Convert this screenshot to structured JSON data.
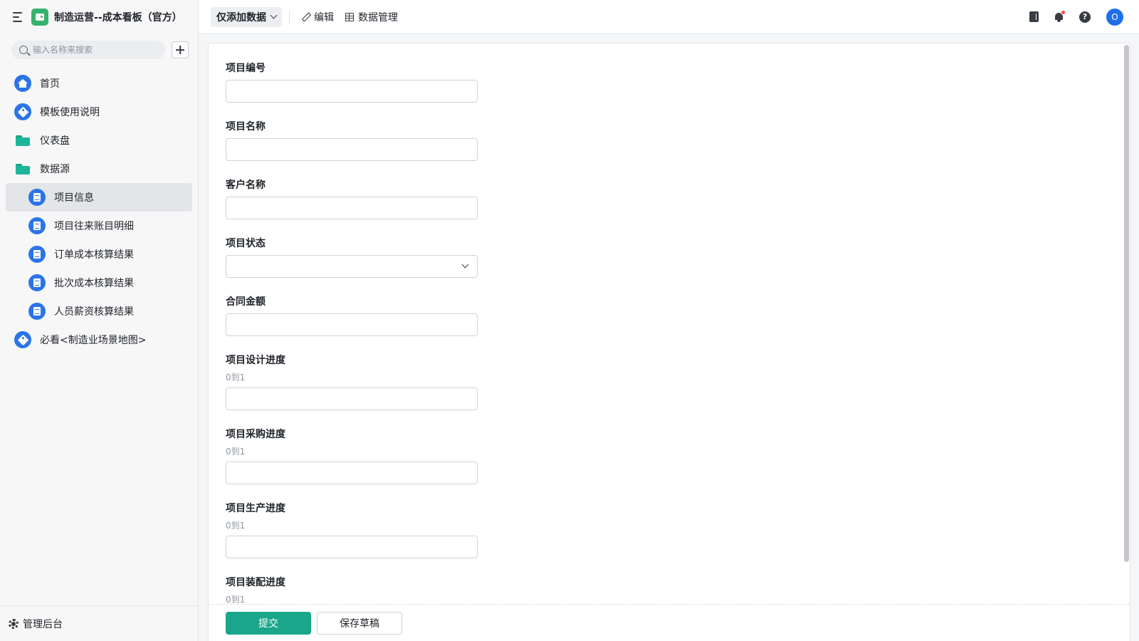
{
  "app": {
    "title": "制造运营--成本看板（官方）"
  },
  "search": {
    "placeholder": "输入名称来搜索"
  },
  "nav": {
    "home": "首页",
    "guide": "模板使用说明",
    "dashboard": "仪表盘",
    "datasource": "数据源",
    "children": [
      "项目信息",
      "项目往来账目明细",
      "订单成本核算结果",
      "批次成本核算结果",
      "人员薪资核算结果"
    ],
    "must_see": "必看<制造业场景地图>"
  },
  "footer": {
    "admin": "管理后台"
  },
  "topbar": {
    "mode": "仅添加数据",
    "edit": "编辑",
    "data_manage": "数据管理",
    "avatar_letter": "O"
  },
  "form": {
    "fields": [
      {
        "label": "项目编号",
        "type": "text",
        "value": ""
      },
      {
        "label": "项目名称",
        "type": "text",
        "value": ""
      },
      {
        "label": "客户名称",
        "type": "text",
        "value": ""
      },
      {
        "label": "项目状态",
        "type": "select",
        "value": ""
      },
      {
        "label": "合同金额",
        "type": "text",
        "value": ""
      },
      {
        "label": "项目设计进度",
        "hint": "0到1",
        "type": "text",
        "value": ""
      },
      {
        "label": "项目采购进度",
        "hint": "0到1",
        "type": "text",
        "value": ""
      },
      {
        "label": "项目生产进度",
        "hint": "0到1",
        "type": "text",
        "value": ""
      },
      {
        "label": "项目装配进度",
        "hint": "0到1",
        "type": "text",
        "value": ""
      }
    ],
    "submit": "提交",
    "save_draft": "保存草稿"
  },
  "colors": {
    "accent": "#19a68a",
    "nav_icon_blue": "#2a74e8",
    "folder_green": "#1cb59a",
    "notification_dot": "#f54a45"
  }
}
